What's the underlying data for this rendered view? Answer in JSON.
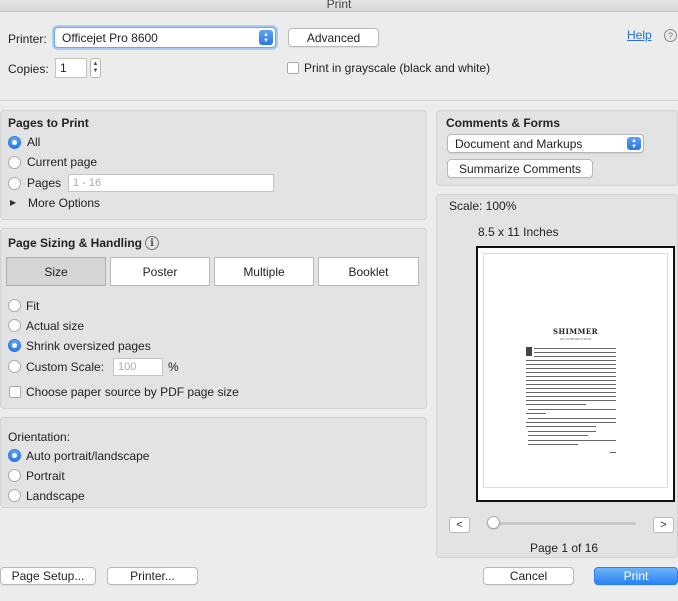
{
  "window": {
    "title": "Print"
  },
  "printer": {
    "label": "Printer:",
    "selected": "Officejet Pro 8600",
    "advanced_label": "Advanced",
    "help_label": "Help",
    "help_icon_glyph": "?"
  },
  "copies": {
    "label": "Copies:",
    "value": "1",
    "grayscale_label": "Print in grayscale (black and white)"
  },
  "pages_to_print": {
    "title": "Pages to Print",
    "all_label": "All",
    "current_label": "Current page",
    "pages_label": "Pages",
    "pages_placeholder": "1 - 16",
    "more_options_label": "More Options",
    "selected": "All"
  },
  "comments_forms": {
    "title": "Comments & Forms",
    "selected": "Document and Markups",
    "summarize_label": "Summarize Comments"
  },
  "sizing": {
    "title": "Page Sizing & Handling",
    "tabs": [
      "Size",
      "Poster",
      "Multiple",
      "Booklet"
    ],
    "selected_tab": "Size",
    "fit_label": "Fit",
    "actual_label": "Actual size",
    "shrink_label": "Shrink oversized pages",
    "custom_label": "Custom Scale:",
    "custom_placeholder": "100",
    "percent": "%",
    "paper_source_label": "Choose paper source by PDF page size",
    "selected_option": "Shrink oversized pages"
  },
  "orientation": {
    "title": "Orientation:",
    "auto_label": "Auto portrait/landscape",
    "portrait_label": "Portrait",
    "landscape_label": "Landscape",
    "selected": "Auto portrait/landscape"
  },
  "preview": {
    "scale": "Scale: 100%",
    "paper_size": "8.5 x 11 Inches",
    "doc_title": "SHIMMER",
    "doc_subtitle": "AN INTRODUCTION",
    "prev_label": "<",
    "next_label": ">",
    "page_indicator": "Page 1 of 16",
    "slider_position": 0
  },
  "footer": {
    "page_setup_label": "Page Setup...",
    "printer_label": "Printer...",
    "cancel_label": "Cancel",
    "print_label": "Print"
  },
  "colors": {
    "accent": "#2a84f2",
    "background": "#ececec",
    "panel": "#e3e3e3",
    "link": "#2a6fd6"
  },
  "icons": {
    "popup_arrows": "chevron-updown-icon",
    "info": "info-icon",
    "help": "help-icon",
    "disclosure": "disclosure-triangle-icon"
  }
}
